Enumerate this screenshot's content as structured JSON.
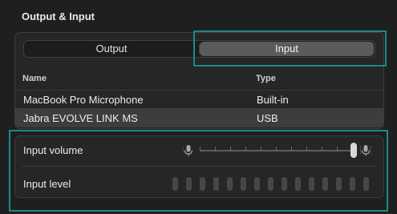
{
  "section": {
    "title": "Output & Input"
  },
  "tabs": {
    "output_label": "Output",
    "input_label": "Input",
    "selected": "Input"
  },
  "table": {
    "columns": [
      "Name",
      "Type"
    ],
    "rows": [
      {
        "name": "MacBook Pro Microphone",
        "type": "Built-in",
        "selected": false
      },
      {
        "name": "Jabra EVOLVE LINK MS",
        "type": "USB",
        "selected": true
      }
    ]
  },
  "input_volume": {
    "label": "Input volume",
    "level": 1.0
  },
  "input_level": {
    "label": "Input level",
    "segments_total": 15,
    "segments_active": 0
  },
  "colors": {
    "background": "#1f1f1f",
    "highlight": "#1a8a8a",
    "selected_row": "#3d3d3d"
  }
}
